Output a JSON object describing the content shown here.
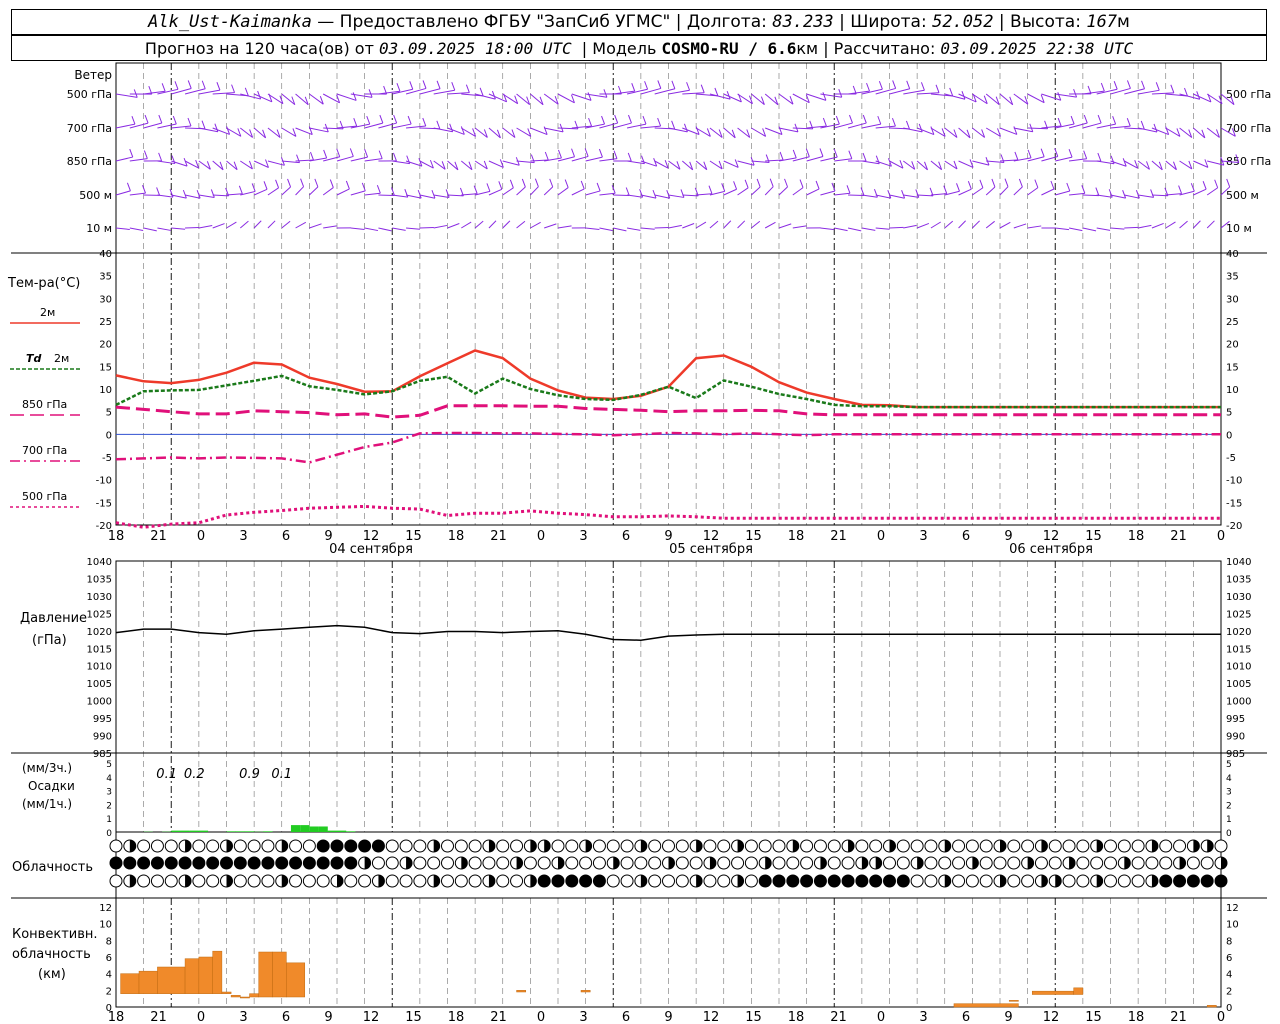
{
  "header": {
    "station": "Alk_Ust-Kaimanka",
    "provider": " — Предоставлено ФГБУ \"ЗапСиб УГМС\" | Долгота: ",
    "longitude": "83.233",
    "lat_label": " | Широта: ",
    "latitude": "52.052",
    "alt_label": " | Высота: ",
    "altitude": "167",
    "alt_unit": "м",
    "forecast_label": "Прогноз на 120 часа(ов) от ",
    "run_time": "03.09.2025 18:00 UTC",
    "model_label": "  | Модель ",
    "model": "COSMO-RU / 6.6",
    "model_unit": "км",
    "calc_label": " | Рассчитано: ",
    "calc_time": "03.09.2025 22:38 UTC"
  },
  "labels": {
    "wind": "Ветер",
    "levels": [
      "500 гПа",
      "700 гПа",
      "850 гПа",
      "500 м",
      "10  м"
    ],
    "temp": "Тем-ра(°С)",
    "t2m": "2м",
    "td": "Td",
    "td2m": "2м",
    "t850": "850 гПа",
    "t700": "700 гПа",
    "t500": "500 гПа",
    "pressure": "Давление",
    "pressure_unit": "(гПа)",
    "precip_3h": "(мм/3ч.)",
    "precip": "Осадки",
    "precip_1h": "(мм/1ч.)",
    "cloud": "Облачность",
    "conv1": "Конвективн.",
    "conv2": "облачность",
    "conv3": "(км)"
  },
  "dates": [
    "04 сентября",
    "05 сентября",
    "06 сентября"
  ],
  "hour_labels": [
    "18",
    "21",
    "0",
    "3",
    "6",
    "9",
    "12",
    "15",
    "18",
    "21",
    "0",
    "3",
    "6",
    "9",
    "12",
    "15",
    "18",
    "21",
    "0",
    "3",
    "6",
    "9",
    "12",
    "15",
    "18",
    "21",
    "0"
  ],
  "colors": {
    "wind": "#8a2be2",
    "t2m": "#ee3a2a",
    "td": "#1a7a1a",
    "t850": "#e0107a",
    "zero": "#3050d0",
    "precip": "#22cc22",
    "conv": "#f08a2a"
  },
  "chart_data": [
    {
      "type": "line",
      "title": "Тем-ра(°С)",
      "ylim": [
        -20,
        40
      ],
      "x_hours": [
        0,
        3,
        6,
        9,
        12,
        15,
        18,
        21,
        24,
        27,
        30,
        33,
        36,
        39,
        42,
        45,
        48,
        51,
        54,
        57,
        60,
        63,
        66,
        69,
        72,
        75,
        78,
        81,
        84,
        87,
        90,
        93,
        96,
        99,
        102,
        105,
        108,
        111,
        114,
        117,
        120
      ],
      "series": [
        {
          "name": "2м",
          "values": [
            13,
            11.7,
            11.3,
            12,
            13.6,
            15.8,
            15.4,
            12.5,
            11.1,
            9.4,
            9.5,
            12.8,
            15.7,
            18.5,
            16.8,
            12.3,
            9.7,
            8.1,
            7.8,
            8.5,
            10.5,
            16.8,
            17.4,
            14.9,
            11.5,
            9.2,
            7.8,
            6.5,
            6.4,
            6,
            6,
            6,
            6,
            6,
            6,
            6,
            6,
            6,
            6,
            6,
            6
          ]
        },
        {
          "name": "Td 2м",
          "values": [
            6.5,
            9.5,
            9.7,
            9.8,
            10.8,
            11.8,
            12.9,
            10.6,
            9.8,
            8.8,
            9.5,
            11.8,
            12.7,
            9,
            12.3,
            10,
            8.6,
            7.8,
            7.6,
            8.7,
            10.5,
            8,
            11.9,
            10.5,
            8.9,
            7.8,
            6.5,
            6.2,
            6.2,
            6,
            6,
            6,
            6,
            6,
            6,
            6,
            6,
            6,
            6,
            6,
            6
          ]
        },
        {
          "name": "850 гПа",
          "values": [
            6,
            5.5,
            5,
            4.5,
            4.5,
            5.2,
            5,
            4.8,
            4.3,
            4.5,
            3.8,
            4.2,
            6.3,
            6.3,
            6.3,
            6.2,
            6.2,
            5.7,
            5.5,
            5.3,
            5,
            5.2,
            5.2,
            5.3,
            5.2,
            4.5,
            4.3,
            4.3,
            4.3,
            4.3,
            4.3,
            4.3,
            4.3,
            4.3,
            4.3,
            4.3,
            4.3,
            4.3,
            4.3,
            4.3,
            4.3
          ]
        },
        {
          "name": "700 гПа",
          "values": [
            -5.5,
            -5.3,
            -5.1,
            -5.3,
            -5.1,
            -5.2,
            -5.3,
            -6.2,
            -4.5,
            -2.8,
            -1.8,
            0.2,
            0.3,
            0.3,
            0.2,
            0.2,
            0.1,
            0,
            -0.2,
            0,
            0.3,
            0.2,
            0,
            0.2,
            0,
            -0.2,
            0,
            0,
            0,
            0,
            0,
            0,
            0,
            0,
            0,
            0,
            0,
            0,
            0,
            0,
            0
          ]
        },
        {
          "name": "500 гПа",
          "values": [
            -19.5,
            -20.5,
            -19.8,
            -19.5,
            -17.8,
            -17.2,
            -16.8,
            -16.3,
            -16.1,
            -15.9,
            -16.3,
            -16.5,
            -17.9,
            -17.4,
            -17.4,
            -16.9,
            -17.4,
            -17.7,
            -18.2,
            -18.2,
            -18,
            -18.2,
            -18.5,
            -18.5,
            -18.5,
            -18.5,
            -18.5,
            -18.5,
            -18.5,
            -18.5,
            -18.5,
            -18.5,
            -18.5,
            -18.5,
            -18.5,
            -18.5,
            -18.5,
            -18.5,
            -18.5,
            -18.5,
            -18.5
          ]
        }
      ]
    },
    {
      "type": "line",
      "title": "Давление",
      "ylabel": "(гПа)",
      "ylim": [
        985,
        1040
      ],
      "x_hours": [
        0,
        3,
        6,
        9,
        12,
        15,
        18,
        21,
        24,
        27,
        30,
        33,
        36,
        39,
        42,
        45,
        48,
        51,
        54,
        57,
        60,
        63,
        66,
        69,
        72,
        75,
        78,
        81,
        84,
        87,
        90,
        93,
        96,
        99,
        102,
        105,
        108,
        111,
        114,
        117,
        120
      ],
      "series": [
        {
          "name": "",
          "values": [
            1019.5,
            1020.5,
            1020.5,
            1019.5,
            1019,
            1020,
            1020.5,
            1021,
            1021.5,
            1021,
            1019.5,
            1019.2,
            1019.8,
            1019.8,
            1019.5,
            1019.8,
            1020,
            1019,
            1017.5,
            1017.3,
            1018.5,
            1018.8,
            1019,
            1019,
            1019,
            1019,
            1019,
            1019,
            1019,
            1019,
            1019,
            1019,
            1019,
            1019,
            1019,
            1019,
            1019,
            1019,
            1019,
            1019,
            1019
          ]
        }
      ]
    },
    {
      "type": "bar",
      "title": "Осадки",
      "ylabel": "(мм/1ч.)",
      "ylim": [
        0,
        5
      ],
      "x_hours": [
        3,
        5,
        6,
        7,
        8,
        9,
        10,
        11,
        12,
        13,
        14,
        15,
        16,
        17,
        18,
        19,
        20,
        21,
        22,
        23,
        24,
        25
      ],
      "values": [
        0.02,
        0.02,
        0.1,
        0.1,
        0.1,
        0.1,
        0,
        0,
        0.05,
        0.05,
        0.05,
        0.02,
        0.05,
        0,
        0,
        0.5,
        0.5,
        0.4,
        0.4,
        0.1,
        0.1,
        0.05
      ],
      "labels_3h": [
        "0.1",
        "0.2",
        "0.9",
        "0.1"
      ],
      "labels_3h_x": [
        5.5,
        8.5,
        14.5,
        18
      ]
    },
    {
      "type": "bar",
      "title": "Конвективн. облачность",
      "ylabel": "(км)",
      "ylim": [
        0,
        13
      ],
      "bars": [
        [
          0.5,
          2.5,
          1.6,
          4
        ],
        [
          2.5,
          4.5,
          1.6,
          4.3
        ],
        [
          4.5,
          7.5,
          1.6,
          4.8
        ],
        [
          7.5,
          9,
          1.6,
          5.8
        ],
        [
          9,
          10.5,
          1.6,
          6
        ],
        [
          10.5,
          11.5,
          1.6,
          6.7
        ],
        [
          11.5,
          12.5,
          1.6,
          1.8
        ],
        [
          12.5,
          13.5,
          1.2,
          1.4
        ],
        [
          13.5,
          14.5,
          1.2,
          1.2
        ],
        [
          14.5,
          15.5,
          1.2,
          1.6
        ],
        [
          15.5,
          17,
          1.2,
          6.6
        ],
        [
          17,
          18.5,
          1.2,
          6.6
        ],
        [
          18.5,
          20.5,
          1.2,
          5.3
        ],
        [
          43.5,
          44.5,
          1.8,
          2
        ],
        [
          50.5,
          51.5,
          1.8,
          2
        ],
        [
          91,
          98,
          0,
          0.4
        ],
        [
          97,
          98,
          0.7,
          0.8
        ],
        [
          99.5,
          104,
          1.5,
          1.9
        ],
        [
          104,
          105,
          1.5,
          2.3
        ],
        [
          118.5,
          119.5,
          0,
          0.2
        ]
      ]
    }
  ]
}
